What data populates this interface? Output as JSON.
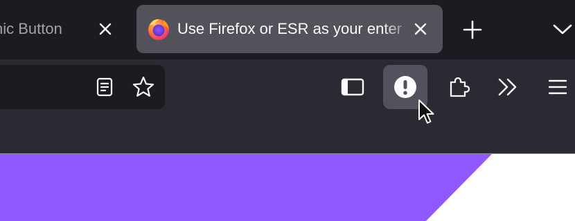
{
  "tabs": [
    {
      "title": "nic Button",
      "close_label": "×"
    },
    {
      "title": "Use Firefox or ESR as your enter",
      "close_label": "×",
      "selected": true
    }
  ],
  "toolbar": {
    "new_tab": "new-tab-icon",
    "list_all_tabs": "chevron-down-icon",
    "urlbar_icons": [
      "reader-view-icon",
      "bookmark-star-icon"
    ],
    "buttons": [
      "sidebar-icon",
      "alert-icon",
      "extensions-icon",
      "overflow-icon",
      "menu-icon"
    ]
  },
  "colors": {
    "tabstrip_bg": "#1c1b22",
    "toolbar_bg": "#2b2a33",
    "selected_tab_bg": "#53525b",
    "active_button_bg": "#52525e",
    "icon_color": "#fbfbfe",
    "banner_purple": "#9059ff",
    "content_bg": "#ffffff"
  }
}
